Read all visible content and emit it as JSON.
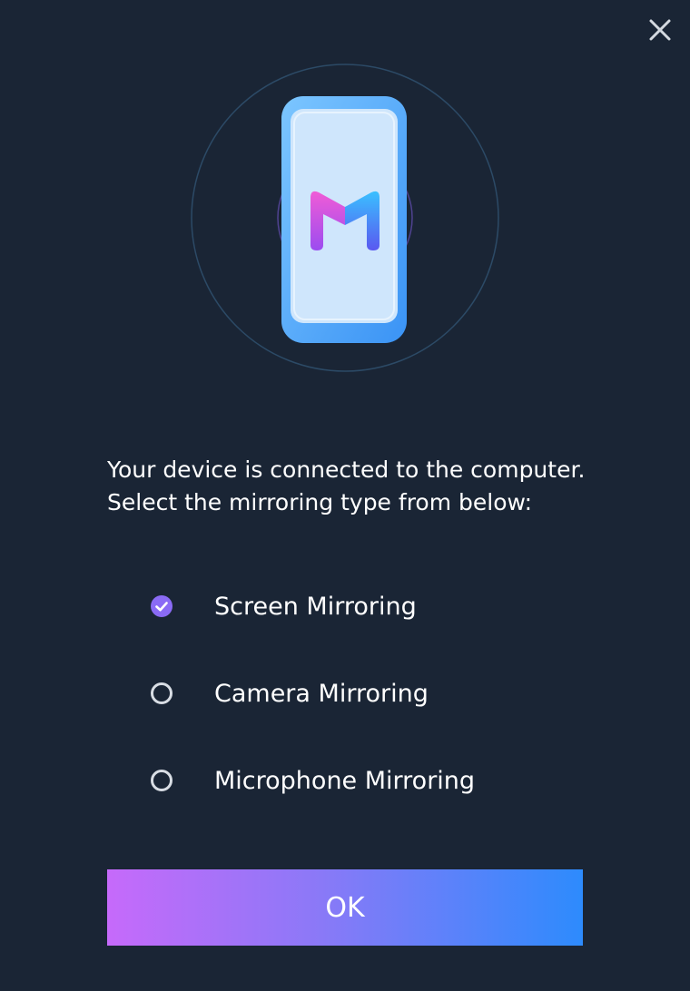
{
  "dialog": {
    "close_icon": "close-icon",
    "hero_icon": "phone-with-m-logo-icon",
    "message_line_1": "Your device is connected to the computer.",
    "message_line_2": "Select the mirroring type from below:",
    "options": [
      {
        "label": "Screen Mirroring",
        "selected": true
      },
      {
        "label": "Camera Mirroring",
        "selected": false
      },
      {
        "label": "Microphone Mirroring",
        "selected": false
      }
    ],
    "ok_label": "OK",
    "colors": {
      "background": "#1a2535",
      "selected_radio": "#8a6bf5",
      "button_gradient_start": "#c66afa",
      "button_gradient_end": "#2d8bfd",
      "phone_body": "#5cb3fb",
      "phone_screen": "#cfe6fc"
    }
  }
}
